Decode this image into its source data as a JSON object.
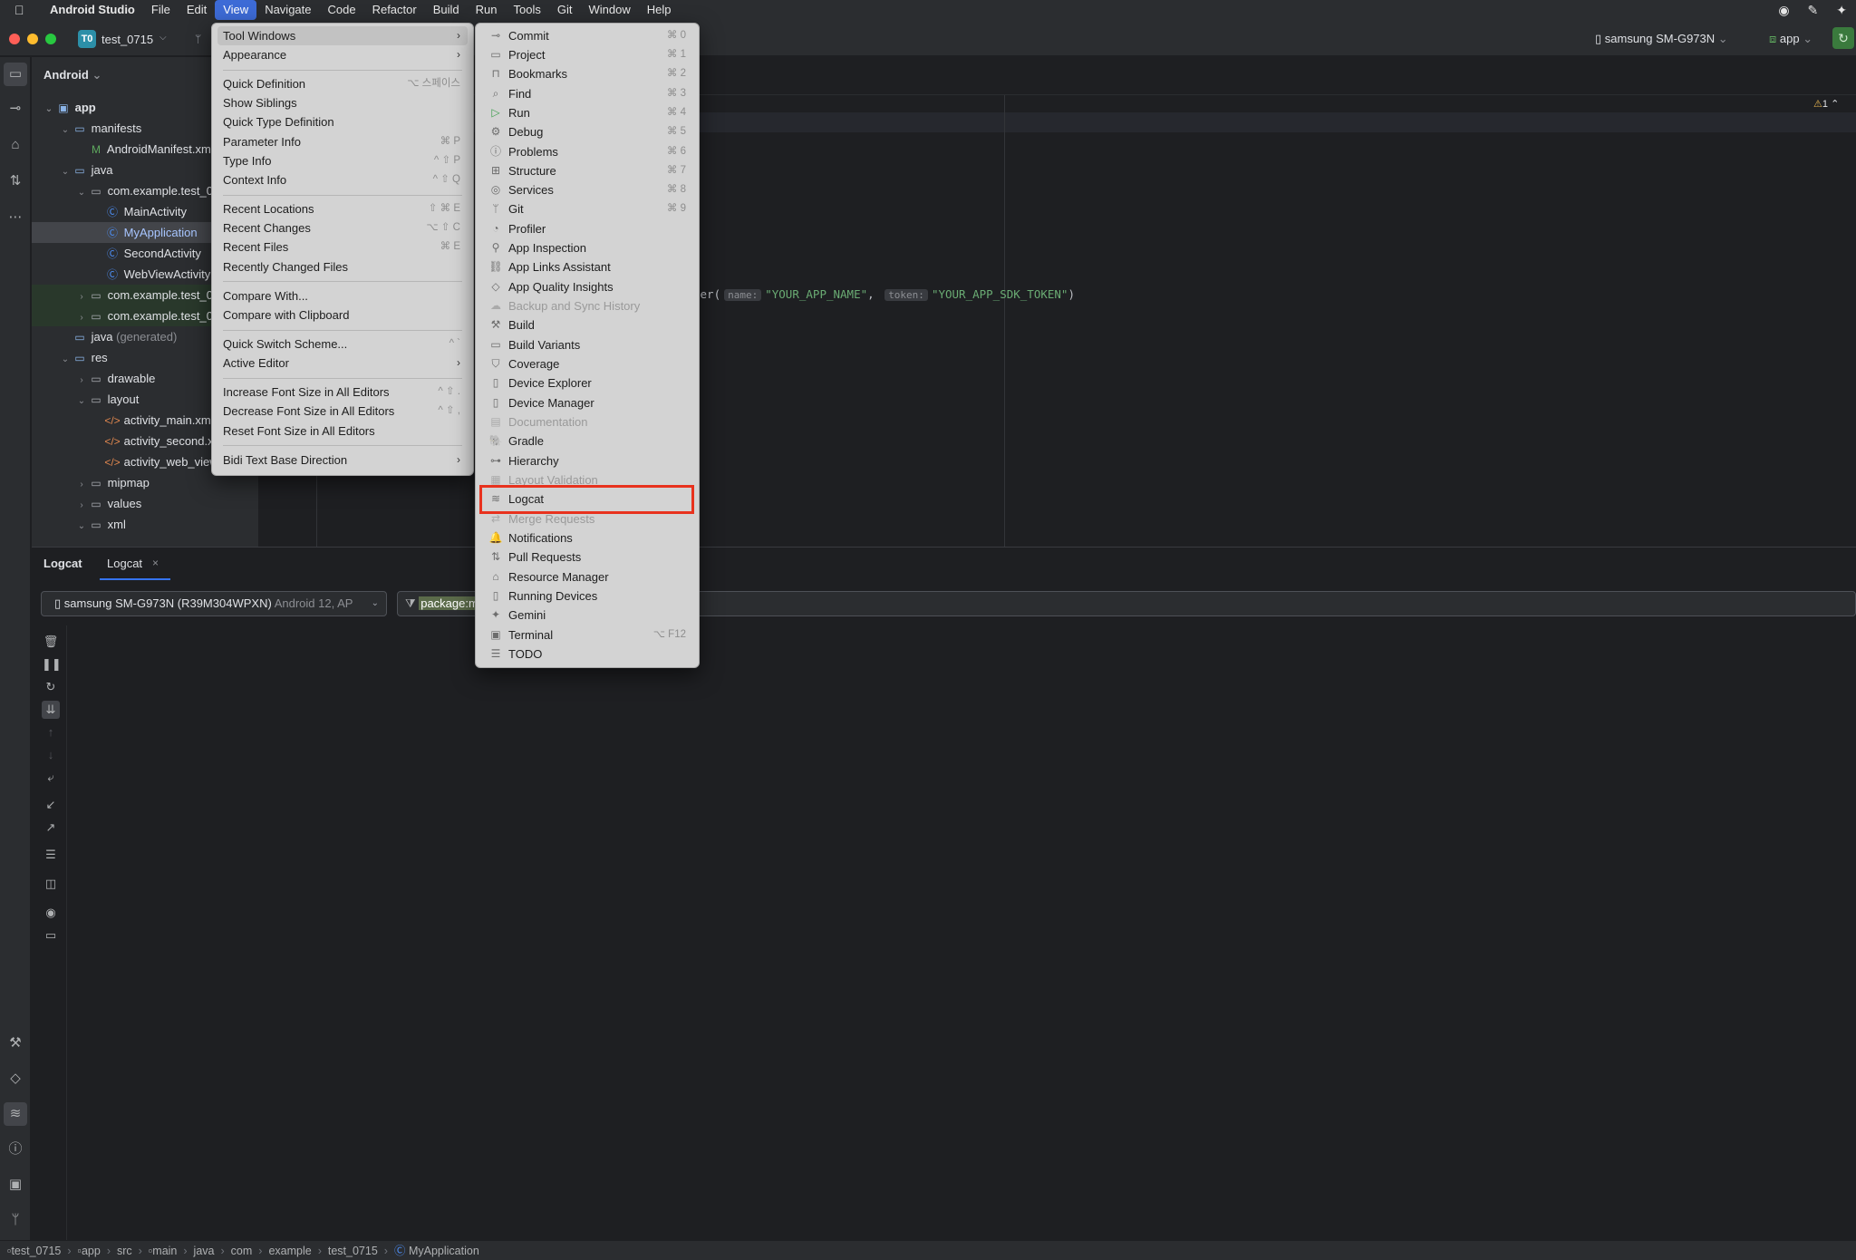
{
  "macbar": {
    "apple_icon": "apple-logo",
    "items": [
      "Android Studio",
      "File",
      "Edit",
      "View",
      "Navigate",
      "Code",
      "Refactor",
      "Build",
      "Run",
      "Tools",
      "Git",
      "Window",
      "Help"
    ],
    "active": "View"
  },
  "toolbar": {
    "project_badge": "T0",
    "project_name": "test_0715",
    "device": "samsung SM-G973N",
    "run_config": "app"
  },
  "project_panel": {
    "header": "Android",
    "rows": [
      {
        "label": "app",
        "bold": true
      },
      {
        "label": "manifests"
      },
      {
        "label": "AndroidManifest.xml"
      },
      {
        "label": "java"
      },
      {
        "label": "com.example.test_0715"
      },
      {
        "label": "MainActivity"
      },
      {
        "label": "MyApplication"
      },
      {
        "label": "SecondActivity"
      },
      {
        "label": "WebViewActivity"
      },
      {
        "label": "com.example.test_0715"
      },
      {
        "label": "com.example.test_0715"
      },
      {
        "label": "java",
        "suffix": "(generated)"
      },
      {
        "label": "res"
      },
      {
        "label": "drawable"
      },
      {
        "label": "layout"
      },
      {
        "label": "activity_main.xml"
      },
      {
        "label": "activity_second.xml"
      },
      {
        "label": "activity_web_view.xml"
      },
      {
        "label": "mipmap"
      },
      {
        "label": "values"
      },
      {
        "label": "xml"
      }
    ]
  },
  "editor": {
    "warning_count": "1",
    "code_prefix": "der(",
    "hint_name": "name:",
    "arg_name": "\"YOUR_APP_NAME\"",
    "comma": ",",
    "hint_token": "token:",
    "arg_token": "\"YOUR_APP_SDK_TOKEN\"",
    "code_suffix": ")"
  },
  "view_menu": {
    "items": [
      {
        "label": "Tool Windows",
        "arrow": true,
        "highlighted": true
      },
      {
        "label": "Appearance",
        "arrow": true
      },
      {
        "label": "Quick Definition",
        "shortcut": "⌥ 스페이스"
      },
      {
        "label": "Show Siblings"
      },
      {
        "label": "Quick Type Definition"
      },
      {
        "label": "Parameter Info",
        "shortcut": "⌘ P"
      },
      {
        "label": "Type Info",
        "shortcut": "^ ⇧ P"
      },
      {
        "label": "Context Info",
        "shortcut": "^ ⇧ Q"
      },
      {
        "label": "Recent Locations",
        "shortcut": "⇧ ⌘ E"
      },
      {
        "label": "Recent Changes",
        "shortcut": "⌥ ⇧ C"
      },
      {
        "label": "Recent Files",
        "shortcut": "⌘ E"
      },
      {
        "label": "Recently Changed Files"
      },
      {
        "label": "Compare With..."
      },
      {
        "label": "Compare with Clipboard"
      },
      {
        "label": "Quick Switch Scheme...",
        "shortcut": "^ `"
      },
      {
        "label": "Active Editor",
        "arrow": true
      },
      {
        "label": "Increase Font Size in All Editors",
        "shortcut": "^ ⇧ ."
      },
      {
        "label": "Decrease Font Size in All Editors",
        "shortcut": "^ ⇧ ,"
      },
      {
        "label": "Reset Font Size in All Editors"
      },
      {
        "label": "Bidi Text Base Direction",
        "arrow": true
      }
    ]
  },
  "tool_windows_menu": {
    "items": [
      {
        "label": "Commit",
        "shortcut": "⌘ 0",
        "icon": "commit-icon"
      },
      {
        "label": "Project",
        "shortcut": "⌘ 1",
        "icon": "folder-icon"
      },
      {
        "label": "Bookmarks",
        "shortcut": "⌘ 2",
        "icon": "bookmark-icon"
      },
      {
        "label": "Find",
        "shortcut": "⌘ 3",
        "icon": "find-icon"
      },
      {
        "label": "Run",
        "shortcut": "⌘ 4",
        "icon": "run-icon"
      },
      {
        "label": "Debug",
        "shortcut": "⌘ 5",
        "icon": "debug-icon"
      },
      {
        "label": "Problems",
        "shortcut": "⌘ 6",
        "icon": "problems-icon"
      },
      {
        "label": "Structure",
        "shortcut": "⌘ 7",
        "icon": "structure-icon"
      },
      {
        "label": "Services",
        "shortcut": "⌘ 8",
        "icon": "services-icon"
      },
      {
        "label": "Git",
        "shortcut": "⌘ 9",
        "icon": "git-icon"
      },
      {
        "label": "Profiler",
        "icon": "profiler-icon"
      },
      {
        "label": "App Inspection",
        "icon": "app-inspection-icon"
      },
      {
        "label": "App Links Assistant",
        "icon": "links-icon"
      },
      {
        "label": "App Quality Insights",
        "icon": "quality-icon"
      },
      {
        "label": "Backup and Sync History",
        "disabled": true,
        "icon": "backup-icon"
      },
      {
        "label": "Build",
        "icon": "build-icon"
      },
      {
        "label": "Build Variants",
        "icon": "build-variants-icon"
      },
      {
        "label": "Coverage",
        "icon": "coverage-icon"
      },
      {
        "label": "Device Explorer",
        "icon": "device-explorer-icon"
      },
      {
        "label": "Device Manager",
        "icon": "device-manager-icon"
      },
      {
        "label": "Documentation",
        "disabled": true,
        "icon": "documentation-icon"
      },
      {
        "label": "Gradle",
        "icon": "gradle-icon"
      },
      {
        "label": "Hierarchy",
        "icon": "hierarchy-icon"
      },
      {
        "label": "Layout Validation",
        "disabled": true,
        "icon": "layout-validation-icon"
      },
      {
        "label": "Logcat",
        "icon": "logcat-icon",
        "highlighted_box": true
      },
      {
        "label": "Merge Requests",
        "disabled": true,
        "icon": "merge-requests-icon"
      },
      {
        "label": "Notifications",
        "icon": "notifications-icon"
      },
      {
        "label": "Pull Requests",
        "icon": "pull-requests-icon"
      },
      {
        "label": "Resource Manager",
        "icon": "resource-manager-icon"
      },
      {
        "label": "Running Devices",
        "icon": "running-devices-icon"
      },
      {
        "label": "Gemini",
        "icon": "gemini-icon"
      },
      {
        "label": "Terminal",
        "shortcut": "⌥ F12",
        "icon": "terminal-icon"
      },
      {
        "label": "TODO",
        "icon": "todo-icon"
      }
    ]
  },
  "logcat": {
    "panel_title": "Logcat",
    "tab_label": "Logcat",
    "device_select": "samsung SM-G973N (R39M304WPXN)",
    "device_sub": "Android 12, AP",
    "filter_query": "package:m"
  },
  "statusbar": {
    "crumbs": [
      "test_0715",
      "app",
      "src",
      "main",
      "java",
      "com",
      "example",
      "test_0715",
      "MyApplication"
    ]
  },
  "colors": {
    "accent": "#3574f0",
    "highlight_box": "#e8321e",
    "menu_bg": "#d3d3d3",
    "ide_bg": "#1e1f22"
  }
}
